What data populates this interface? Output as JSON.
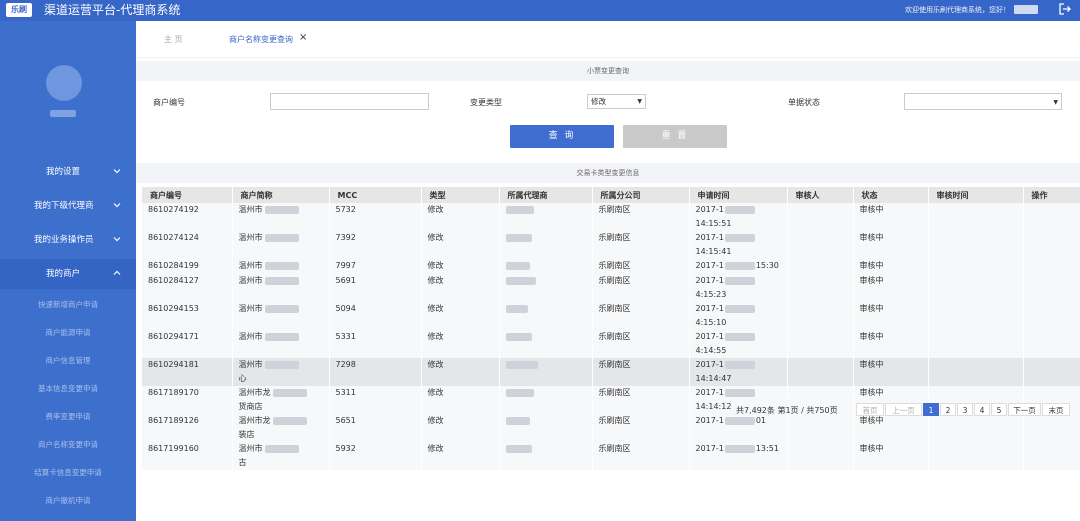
{
  "header": {
    "logo": "乐刷",
    "title": "渠道运营平台-代理商系统",
    "welcome": "欢迎使用乐刷代理商系统，您好！"
  },
  "sidebar": {
    "menu": [
      {
        "label": "我的设置"
      },
      {
        "label": "我的下级代理商"
      },
      {
        "label": "我的业务操作员"
      },
      {
        "label": "我的商户"
      }
    ],
    "submenu": [
      "快速新增商户申请",
      "商户能源申请",
      "商户信息管理",
      "基本信息变更申请",
      "费率变更申请",
      "商户名称变更申请",
      "结算卡信息变更申请",
      "商户撤机申请"
    ]
  },
  "tabs": {
    "home": "主 页",
    "active": "商户名称变更查询"
  },
  "search": {
    "section_title": "小票变更查询",
    "merchant_no_label": "商户编号",
    "change_type_label": "变更类型",
    "change_type_value": "修改",
    "status_label": "单据状态",
    "query_button": "查 询",
    "reset_button": "重 置"
  },
  "results": {
    "section_title": "交易卡类型变更信息",
    "columns": [
      "商户编号",
      "商户简称",
      "MCC",
      "类型",
      "所属代理商",
      "所属分公司",
      "申请时间",
      "审核人",
      "状态",
      "审核时间",
      "操作"
    ],
    "rows": [
      {
        "no": "8610274192",
        "name": "温州市",
        "mcc": "5732",
        "type": "修改",
        "branch": "乐刷南区",
        "time": "2017-1",
        "time2": "14:15:51",
        "status": "审核中"
      },
      {
        "no": "8610274124",
        "name": "温州市",
        "mcc": "7392",
        "type": "修改",
        "branch": "乐刷南区",
        "time": "2017-1",
        "time2": "14:15:41",
        "status": "审核中"
      },
      {
        "no": "8610284199",
        "name": "温州市",
        "mcc": "7997",
        "type": "修改",
        "branch": "乐刷南区",
        "time": "2017-1",
        "time2": "15:30",
        "status": "审核中"
      },
      {
        "no": "8610284127",
        "name": "温州市",
        "mcc": "5691",
        "type": "修改",
        "branch": "乐刷南区",
        "time": "2017-1",
        "time2": "4:15:23",
        "status": "审核中"
      },
      {
        "no": "8610294153",
        "name": "温州市",
        "mcc": "5094",
        "type": "修改",
        "branch": "乐刷南区",
        "time": "2017-1",
        "time2": "4:15:10",
        "status": "审核中"
      },
      {
        "no": "8610294171",
        "name": "温州市",
        "mcc": "5331",
        "type": "修改",
        "branch": "乐刷南区",
        "time": "2017-1",
        "time2": "4:14:55",
        "status": "审核中"
      },
      {
        "no": "8610294181",
        "name": "温州市",
        "name2": "心",
        "mcc": "7298",
        "type": "修改",
        "branch": "乐刷南区",
        "time": "2017-1",
        "time2": "14:14:47",
        "status": "审核中"
      },
      {
        "no": "8617189170",
        "name": "温州市龙",
        "name2": "货商店",
        "mcc": "5311",
        "type": "修改",
        "branch": "乐刷南区",
        "time": "2017-1",
        "time2": "14:14:12",
        "status": "审核中"
      },
      {
        "no": "8617189126",
        "name": "温州市龙",
        "name2": "装店",
        "mcc": "5651",
        "type": "修改",
        "branch": "乐刷南区",
        "time": "2017-1",
        "time2": "01",
        "status": "审核中"
      },
      {
        "no": "8617199160",
        "name": "温州市",
        "name2": "古",
        "mcc": "5932",
        "type": "修改",
        "branch": "乐刷南区",
        "time": "2017-1",
        "time2": "13:51",
        "status": "审核中"
      }
    ]
  },
  "pagination": {
    "info": "共7,492条 第1页 / 共750页",
    "first": "首页",
    "prev": "上一页",
    "pages": [
      "1",
      "2",
      "3",
      "4",
      "5"
    ],
    "next": "下一页",
    "last": "末页",
    "current_page": 1
  },
  "colors": {
    "header_bg": "#3766c9",
    "sidebar_bg": "#3d6fcd",
    "primary_button": "#3f6ed0",
    "reset_button": "#c9c9c9"
  }
}
